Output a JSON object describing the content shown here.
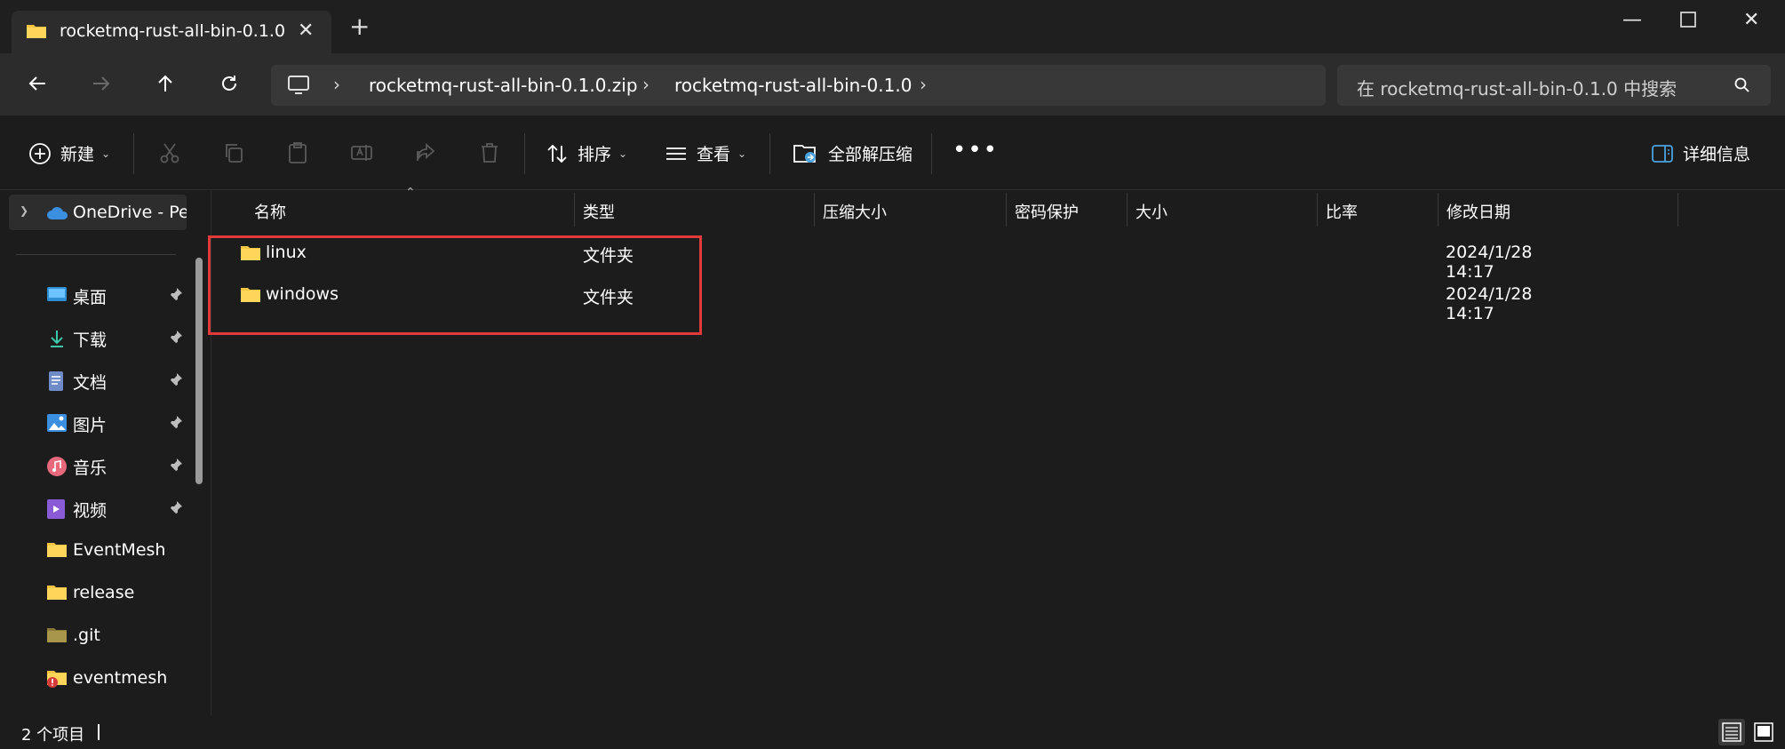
{
  "tab": {
    "title": "rocketmq-rust-all-bin-0.1.0"
  },
  "address": {
    "crumbs": [
      "rocketmq-rust-all-bin-0.1.0.zip",
      "rocketmq-rust-all-bin-0.1.0"
    ]
  },
  "search": {
    "placeholder": "在 rocketmq-rust-all-bin-0.1.0 中搜索"
  },
  "toolbar": {
    "new_label": "新建",
    "sort_label": "排序",
    "view_label": "查看",
    "extract_label": "全部解压缩",
    "details_label": "详细信息"
  },
  "sidebar": {
    "onedrive": "OneDrive - Per",
    "quick": [
      {
        "label": "桌面",
        "icon": "desktop-icon",
        "pinned": true
      },
      {
        "label": "下载",
        "icon": "download-icon",
        "pinned": true
      },
      {
        "label": "文档",
        "icon": "document-icon",
        "pinned": true
      },
      {
        "label": "图片",
        "icon": "pictures-icon",
        "pinned": true
      },
      {
        "label": "音乐",
        "icon": "music-icon",
        "pinned": true
      },
      {
        "label": "视频",
        "icon": "video-icon",
        "pinned": true
      },
      {
        "label": "EventMesh",
        "icon": "folder-icon",
        "pinned": false
      },
      {
        "label": "release",
        "icon": "folder-icon",
        "pinned": false
      },
      {
        "label": ".git",
        "icon": "folder-icon",
        "pinned": false
      },
      {
        "label": "eventmesh",
        "icon": "folder-icon",
        "pinned": false
      }
    ]
  },
  "columns": [
    "名称",
    "类型",
    "压缩大小",
    "密码保护",
    "大小",
    "比率",
    "修改日期"
  ],
  "files": [
    {
      "name": "linux",
      "type": "文件夹",
      "date": "2024/1/28 14:17"
    },
    {
      "name": "windows",
      "type": "文件夹",
      "date": "2024/1/28 14:17"
    }
  ],
  "status": {
    "count": "2 个项目"
  },
  "colors": {
    "folder": "#f4c542",
    "highlight": "#e03a3a",
    "accent": "#4aa3df"
  }
}
